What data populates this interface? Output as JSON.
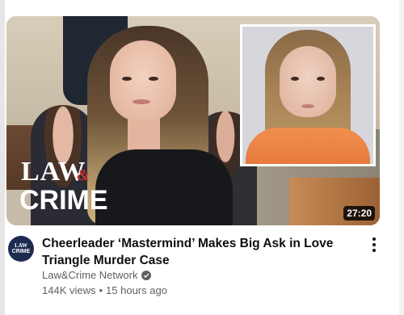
{
  "video": {
    "thumbnail": {
      "logo_law": "LAW",
      "logo_amp": "&",
      "logo_crime": "CRIME",
      "duration": "27:20"
    },
    "channel_avatar": {
      "line1": "LAW",
      "line2": "CRIME"
    },
    "title": "Cheerleader ‘Mastermind’ Makes Big Ask in Love Triangle Murder Case",
    "channel_name": "Law&Crime Network",
    "verified_icon": "check-circle-icon",
    "views": "144K views",
    "separator": "•",
    "age": "15 hours ago",
    "menu_icon": "more-vert-icon"
  },
  "colors": {
    "title": "#0f0f0f",
    "secondary_text": "#606060",
    "logo_accent": "#c73a2e",
    "duration_bg": "#000000"
  }
}
